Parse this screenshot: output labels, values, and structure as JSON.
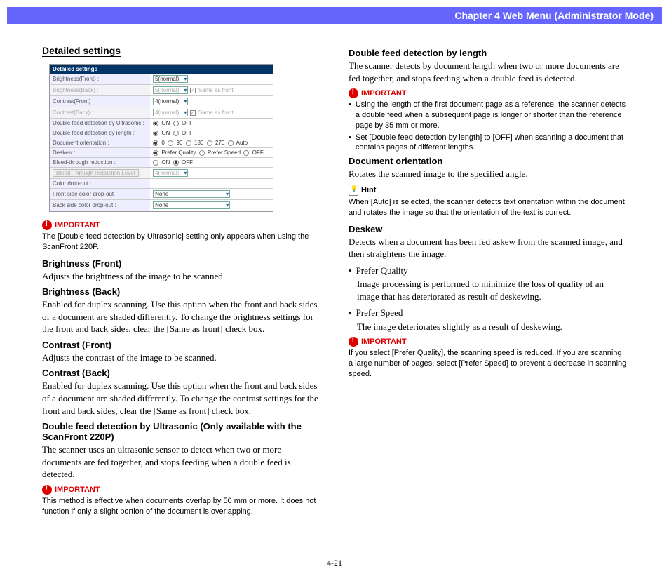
{
  "header": "Chapter 4   Web Menu (Administrator Mode)",
  "page_number": "4-21",
  "left": {
    "title": "Detailed settings",
    "shot": {
      "header": "Detailed settings",
      "rows": [
        {
          "label": "Brightness(Front) :",
          "ctrl_type": "select",
          "val": "5(normal)"
        },
        {
          "label": "Brightness(Back) :",
          "ctrl_type": "select_chk",
          "val": "5(normal)",
          "chk_label": "Same as front",
          "chk_on": true,
          "disabled": true
        },
        {
          "label": "Contrast(Front) :",
          "ctrl_type": "select",
          "val": "4(normal)"
        },
        {
          "label": "Contrast(Back) :",
          "ctrl_type": "select_chk",
          "val": "4(normal)",
          "chk_label": "Same as front",
          "chk_on": true,
          "disabled": true
        },
        {
          "label": "Double feed detection by Ultrasonic :",
          "ctrl_type": "onoff",
          "on": true
        },
        {
          "label": "Double feed detection by length :",
          "ctrl_type": "onoff",
          "on": true
        },
        {
          "label": "Document orientation :",
          "ctrl_type": "orient",
          "opts": [
            "0",
            "90",
            "180",
            "270",
            "Auto"
          ],
          "sel": 0
        },
        {
          "label": "Deskew :",
          "ctrl_type": "deskew",
          "opts": [
            "Prefer Quality",
            "Prefer Speed",
            "OFF"
          ],
          "sel": 0
        },
        {
          "label": "Bleed-through reduction :",
          "ctrl_type": "onoff",
          "on": false
        },
        {
          "label": "",
          "ctrl_type": "btn_sel",
          "btn": "Bleed-Through Reduction Level",
          "val": "4(normal)",
          "disabled": true
        },
        {
          "label": "Color drop-out :",
          "ctrl_type": "text",
          "val": ""
        },
        {
          "label": "Front side color drop-out :",
          "ctrl_type": "select_wide",
          "val": "None"
        },
        {
          "label": "Back side color drop-out :",
          "ctrl_type": "select_wide",
          "val": "None"
        }
      ]
    },
    "imp1_label": "IMPORTANT",
    "imp1_text": "The [Double feed detection by Ultrasonic] setting only appears when using the ScanFront 220P.",
    "h1": "Brightness (Front)",
    "t1": "Adjusts the brightness of the image to be scanned.",
    "h2": "Brightness (Back)",
    "t2": "Enabled for duplex scanning. Use this option when the front and back sides of a document are shaded differently. To change the brightness settings for the front and back sides, clear the [Same as front] check box.",
    "h3": "Contrast (Front)",
    "t3": "Adjusts the contrast of the image to be scanned.",
    "h4": "Contrast (Back)",
    "t4": "Enabled for duplex scanning. Use this option when the front and back sides of a document are shaded differently. To change the contrast settings for the front and back sides, clear the [Same as front] check box.",
    "h5": "Double feed detection by Ultrasonic (Only available with the ScanFront 220P)",
    "t5": "The scanner uses an ultrasonic sensor to detect when two or more documents are fed together, and stops feeding when a double feed is detected.",
    "imp2_label": "IMPORTANT",
    "imp2_text": "This method is effective when documents overlap by 50 mm or more. It does not function if only a slight portion of the document is overlapping."
  },
  "right": {
    "h1": "Double feed detection by length",
    "t1": "The scanner detects by document length when two or more documents are fed together, and stops feeding when a double feed is detected.",
    "imp1_label": "IMPORTANT",
    "imp1_b1": "Using the length of the first document page as a reference, the scanner detects a double feed when a subsequent page is longer or shorter than the reference page by 35 mm or more.",
    "imp1_b2": "Set [Double feed detection by length] to [OFF] when scanning a document that contains pages of different lengths.",
    "h2": "Document orientation",
    "t2": "Rotates the scanned image to the specified angle.",
    "hint_label": "Hint",
    "hint_text": "When [Auto] is selected, the scanner detects text orientation within the document and rotates the image so that the orientation of the text is correct.",
    "h3": "Deskew",
    "t3": "Detects when a document has been fed askew from the scanned image, and then straightens the image.",
    "pq_label": "Prefer Quality",
    "pq_text": "Image processing is performed to minimize the loss of quality of an image that has deteriorated as result of deskewing.",
    "ps_label": "Prefer Speed",
    "ps_text": "The image deteriorates slightly as a result of deskewing.",
    "imp2_label": "IMPORTANT",
    "imp2_text": "If you select [Prefer Quality], the scanning speed is reduced. If you are scanning a large number of pages, select [Prefer Speed] to prevent a decrease in scanning speed."
  }
}
